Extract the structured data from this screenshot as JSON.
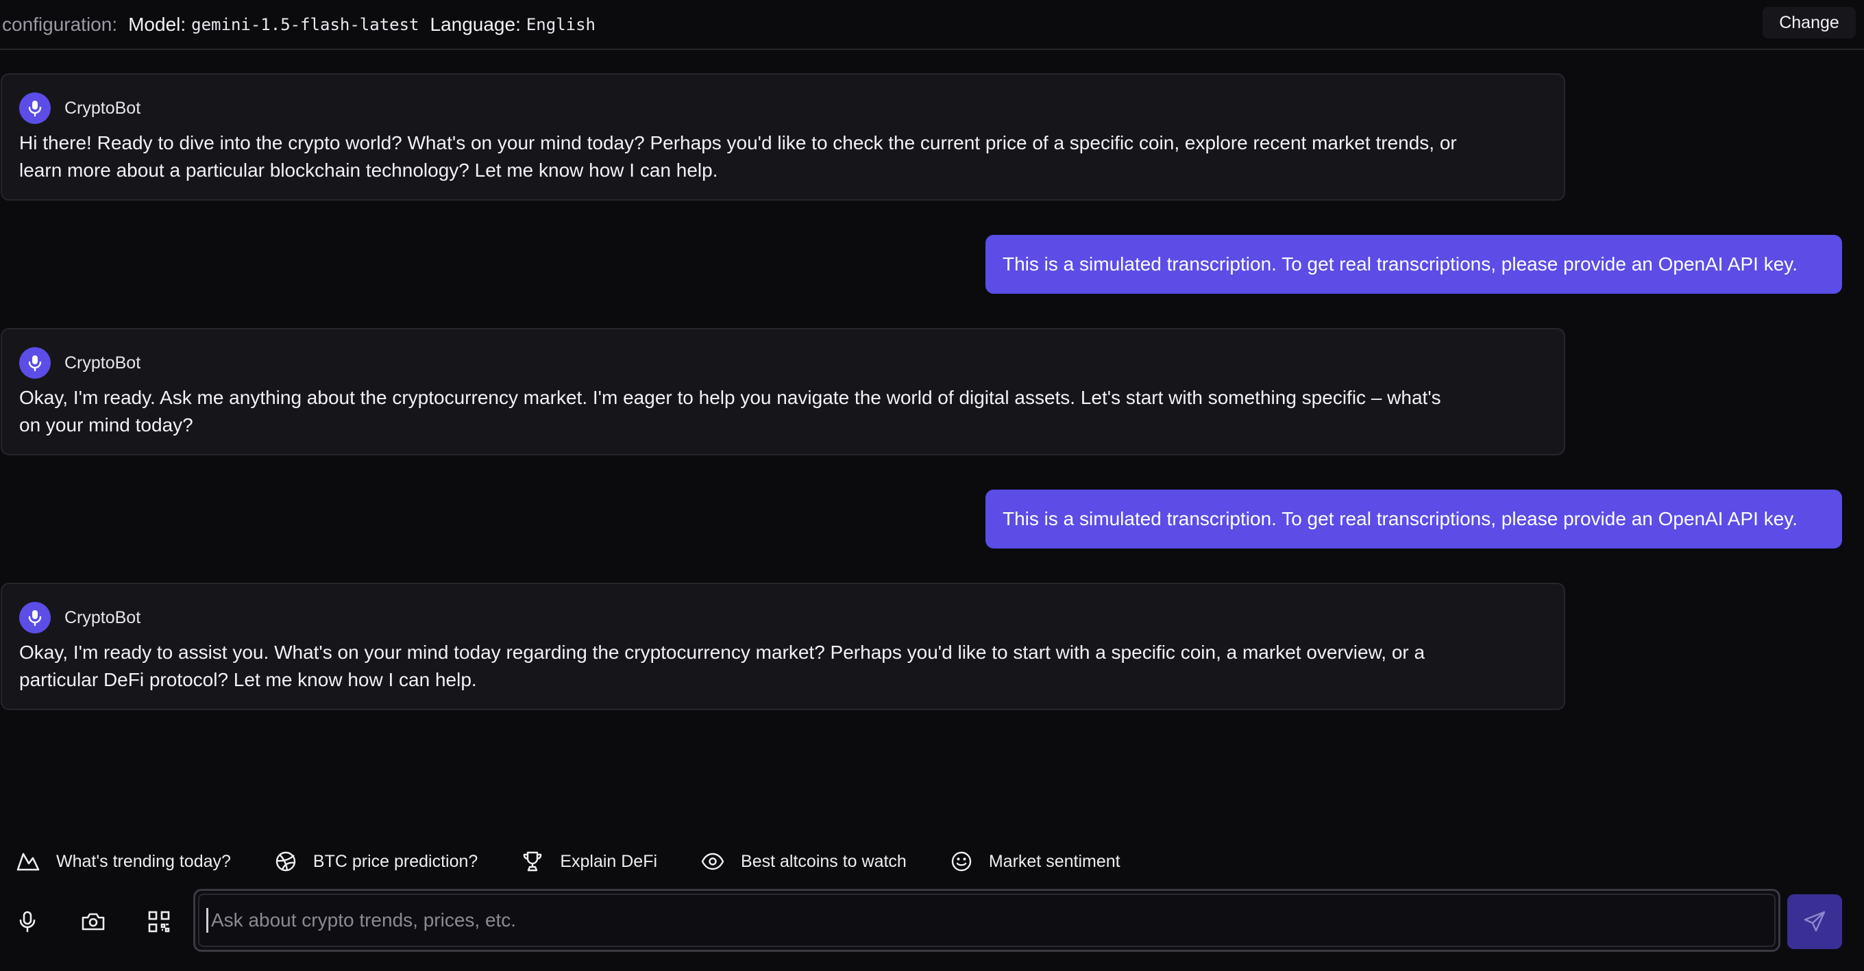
{
  "config": {
    "label": "configuration:",
    "model_label": "Model:",
    "model_value": "gemini-1.5-flash-latest",
    "language_label": "Language:",
    "language_value": "English",
    "change_button": "Change"
  },
  "messages": [
    {
      "role": "bot",
      "name": "CryptoBot",
      "lines": [
        "Hi there! Ready to dive into the crypto world? What's on your mind today? Perhaps you'd like to check the current price of a specific coin, explore recent market trends, or",
        "learn more about a particular blockchain technology? Let me know how I can help."
      ]
    },
    {
      "role": "user",
      "text": "This is a simulated transcription. To get real transcriptions, please provide an OpenAI API key."
    },
    {
      "role": "bot",
      "name": "CryptoBot",
      "lines": [
        "Okay, I'm ready.  Ask me anything about the cryptocurrency market.  I'm eager to help you navigate the world of digital assets.  Let's start with something specific – what's",
        "on your mind today?"
      ]
    },
    {
      "role": "user",
      "text": "This is a simulated transcription. To get real transcriptions, please provide an OpenAI API key."
    },
    {
      "role": "bot",
      "name": "CryptoBot",
      "lines": [
        "Okay, I'm ready to assist you.  What's on your mind today regarding the cryptocurrency market?  Perhaps you'd like to start with a specific coin, a market overview, or a",
        "particular DeFi protocol?  Let me know how I can help."
      ]
    }
  ],
  "suggestions": [
    {
      "label": "What's trending today?",
      "icon": "mountain-icon"
    },
    {
      "label": "BTC price prediction?",
      "icon": "dribbble-icon"
    },
    {
      "label": "Explain DeFi",
      "icon": "trophy-icon"
    },
    {
      "label": "Best altcoins to watch",
      "icon": "eye-icon"
    },
    {
      "label": "Market sentiment",
      "icon": "smile-icon"
    }
  ],
  "input": {
    "placeholder": "Ask about crypto trends, prices, etc.",
    "value": ""
  },
  "tools": [
    "microphone-icon",
    "camera-icon",
    "qr-code-icon"
  ],
  "colors": {
    "accent": "#5b4de6",
    "background": "#0b0b0e",
    "card": "#16161a",
    "send_button": "#3a2f94"
  }
}
